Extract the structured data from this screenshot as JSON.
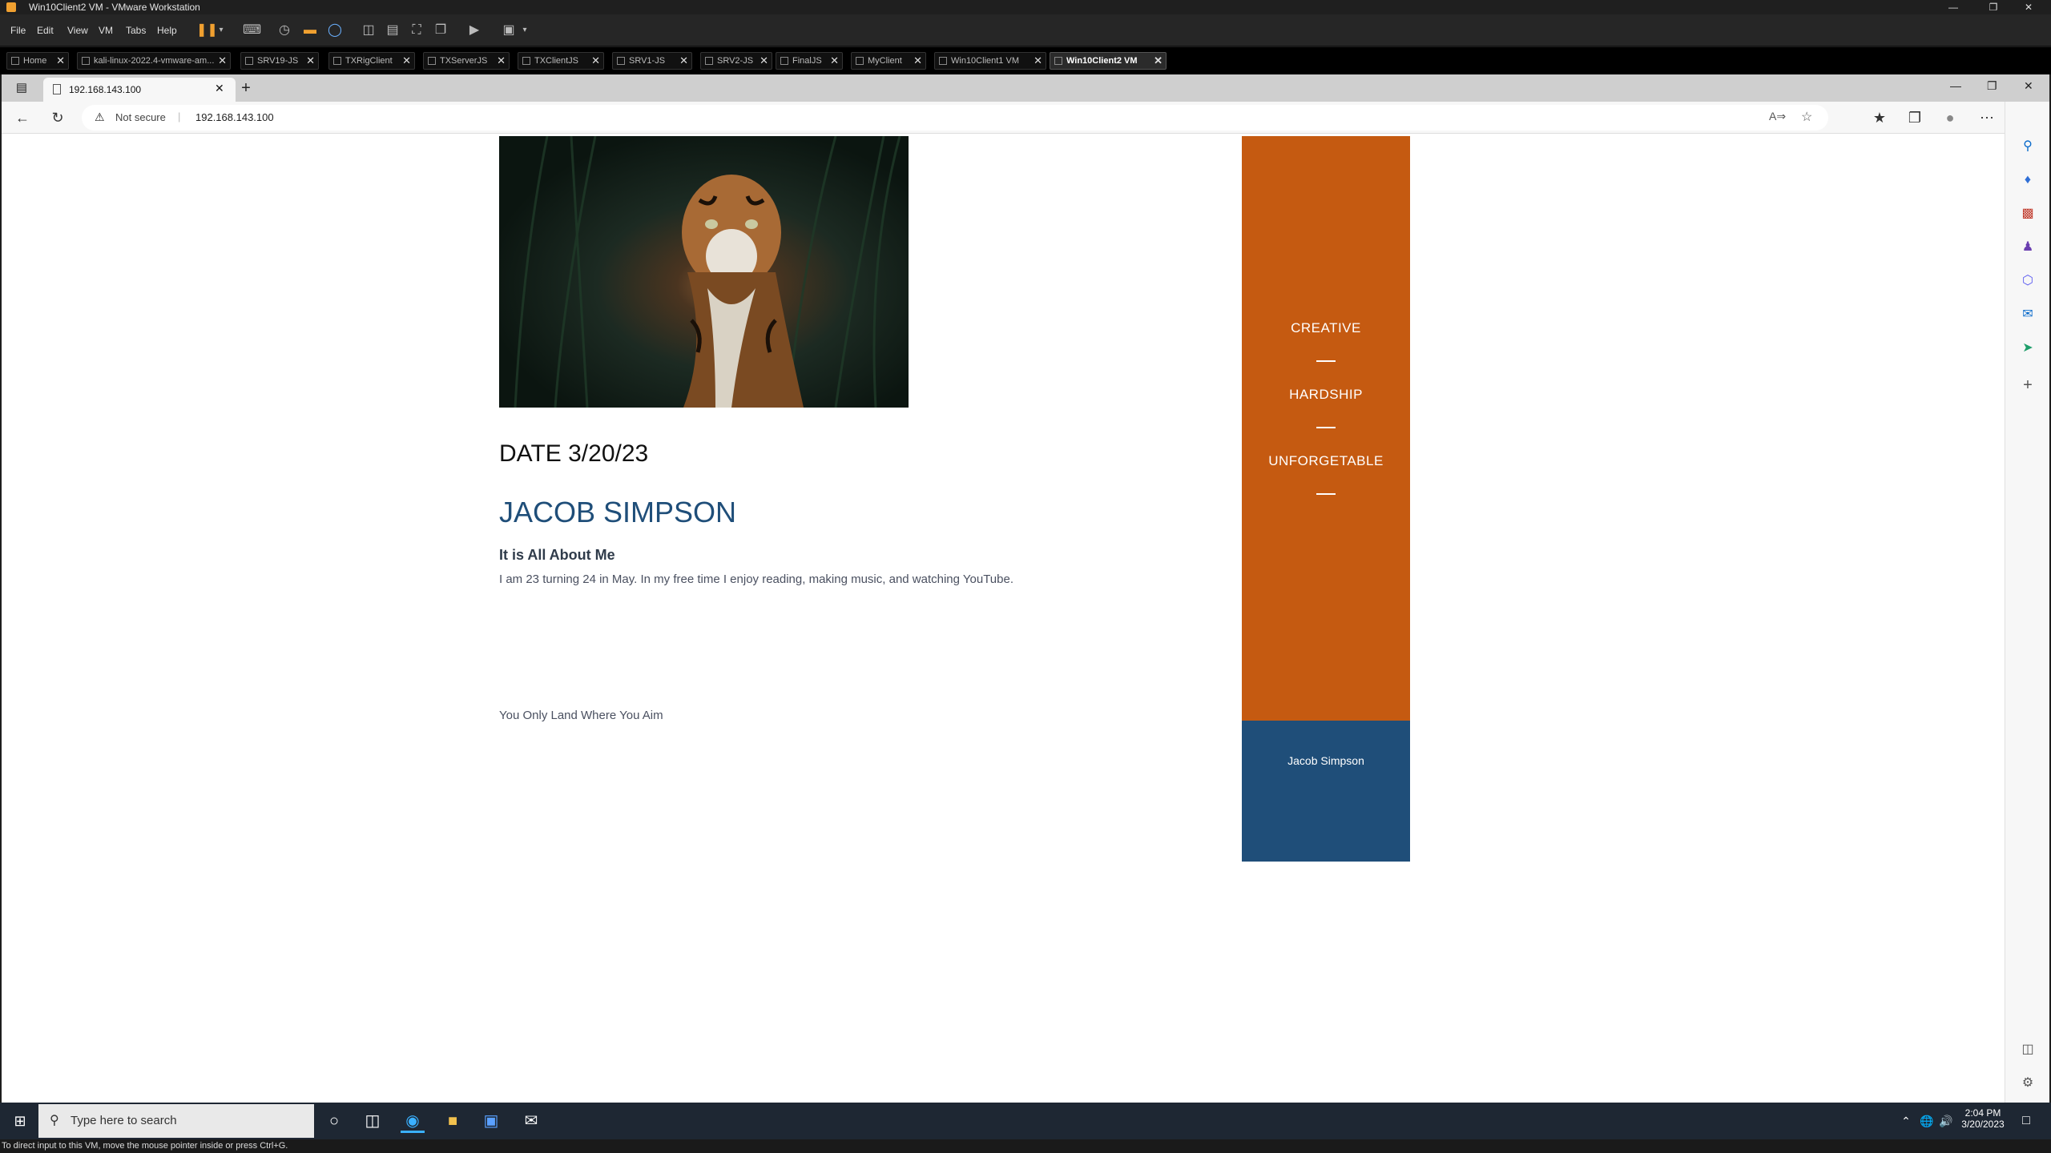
{
  "vmware": {
    "window_title": "Win10Client2 VM - VMware Workstation",
    "menu": [
      "File",
      "Edit",
      "View",
      "VM",
      "Tabs",
      "Help"
    ],
    "tabs": [
      {
        "label": "Home",
        "active": false
      },
      {
        "label": "kali-linux-2022.4-vmware-am...",
        "active": false
      },
      {
        "label": "SRV19-JS",
        "active": false
      },
      {
        "label": "TXRigClient",
        "active": false
      },
      {
        "label": "TXServerJS",
        "active": false
      },
      {
        "label": "TXClientJS",
        "active": false
      },
      {
        "label": "SRV1-JS",
        "active": false
      },
      {
        "label": "SRV2-JS",
        "active": false
      },
      {
        "label": "FinalJS",
        "active": false
      },
      {
        "label": "MyClient",
        "active": false
      },
      {
        "label": "Win10Client1 VM",
        "active": false
      },
      {
        "label": "Win10Client2 VM",
        "active": true
      }
    ],
    "status_bar": "To direct input to this VM, move the mouse pointer inside or press Ctrl+G."
  },
  "browser": {
    "tab_title": "192.168.143.100",
    "security_label": "Not secure",
    "url": "192.168.143.100"
  },
  "page": {
    "date": "DATE 3/20/23",
    "name": "JACOB SIMPSON",
    "about_title": "It is All About Me",
    "about_body": "I am 23 turning 24 in May. In my free time I enjoy reading, making music, and watching YouTube.",
    "motto": "You Only Land Where You Aim",
    "side_words": [
      "CREATIVE",
      "HARDSHIP",
      "UNFORGETABLE"
    ],
    "footer_name": "Jacob Simpson",
    "colors": {
      "orange": "#c55a11",
      "blue": "#1f4e79"
    }
  },
  "taskbar": {
    "search_placeholder": "Type here to search",
    "time": "2:04 PM",
    "date": "3/20/2023"
  }
}
